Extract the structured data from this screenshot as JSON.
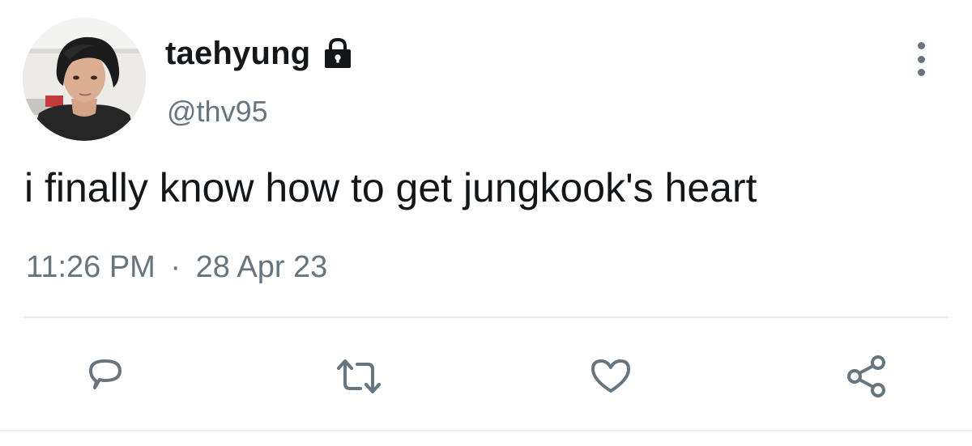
{
  "tweet": {
    "display_name": "taehyung",
    "handle": "@thv95",
    "text": "i finally know how to get jungkook's heart",
    "time": "11:26 PM",
    "separator": "·",
    "date": "28 Apr 23",
    "protected": true
  },
  "icons": {
    "lock": "lock-icon",
    "more": "more-vertical-icon",
    "reply": "reply-icon",
    "retweet": "retweet-icon",
    "like": "heart-icon",
    "share": "share-icon"
  },
  "colors": {
    "text_primary": "#14171a",
    "text_secondary": "#66757f",
    "divider": "#e1e8ed"
  }
}
